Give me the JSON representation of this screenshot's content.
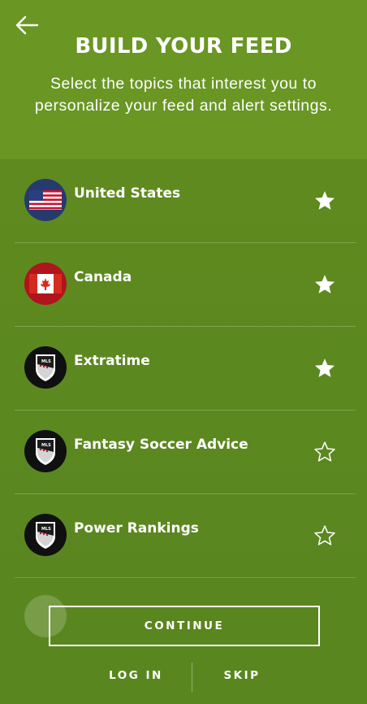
{
  "header": {
    "back_icon": "arrow-left-icon",
    "title": "BUILD YOUR FEED",
    "subtitle": "Select the topics that interest you to personalize your feed and alert settings."
  },
  "topics": [
    {
      "label": "United States",
      "icon": "us-flag-icon",
      "starred": true
    },
    {
      "label": "Canada",
      "icon": "canada-flag-icon",
      "starred": true
    },
    {
      "label": "Extratime",
      "icon": "mls-logo-icon",
      "starred": true
    },
    {
      "label": "Fantasy Soccer Advice",
      "icon": "mls-logo-icon",
      "starred": false
    },
    {
      "label": "Power Rankings",
      "icon": "mls-logo-icon",
      "starred": false
    }
  ],
  "footer": {
    "continue_label": "CONTINUE",
    "login_label": "LOG IN",
    "skip_label": "SKIP"
  },
  "colors": {
    "background": "#5f8a1f",
    "header": "#6a9624",
    "text": "#ffffff"
  }
}
